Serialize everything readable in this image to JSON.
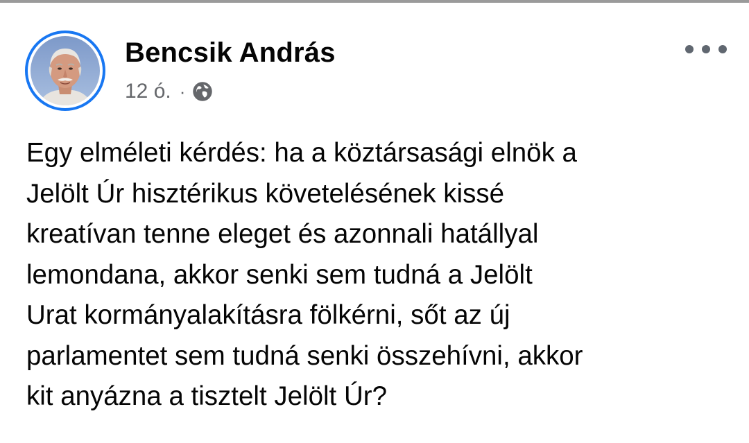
{
  "post": {
    "author": {
      "name": "Bencsik András",
      "avatar_icon": "profile-photo-avatar"
    },
    "timestamp": "12 ó.",
    "separator": "·",
    "privacy_icon": "globe-icon",
    "more_icon": "more-options-icon",
    "body": "Egy elméleti kérdés: ha a köztársasági elnök a\nJelölt Úr hisztérikus követelésének kissé\nkreatívan tenne eleget és azonnali hatállyal\nlemondana, akkor senki sem tudná a Jelölt\nUrat kormányalakításra fölkérni, sőt az új\nparlamentet sem tudná senki összehívni, akkor\nkit anyázna a tisztelt Jelölt Úr?"
  },
  "colors": {
    "accent_ring": "#1877f2",
    "secondary_text": "#65676b",
    "primary_text": "#050505"
  }
}
